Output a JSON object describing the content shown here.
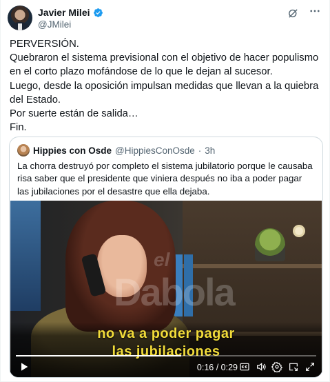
{
  "author": {
    "display_name": "Javier Milei",
    "handle": "@JMilei",
    "verified": true
  },
  "icons": {
    "verified": "verified-badge-icon",
    "grok": "grok-icon",
    "more": "more-options-icon",
    "play": "play-icon",
    "captions": "closed-captions-icon",
    "volume": "volume-icon",
    "settings": "gear-icon",
    "pip": "picture-in-picture-icon",
    "fullscreen": "fullscreen-icon"
  },
  "tweet": {
    "text": "PERVERSIÓN.\nQuebraron el sistema previsional con el objetivo de hacer populismo en el corto plazo mofándose de lo que le dejan al sucesor.\nLuego, desde la oposición impulsan medidas que llevan a la quiebra del Estado.\nPor suerte están de salida…\nFin."
  },
  "quote": {
    "display_name": "Hippies con Osde",
    "handle": "@HippiesConOsde",
    "separator": "·",
    "time": "3h",
    "text": "La chorra destruyó por completo el sistema jubilatorio porque le causaba risa saber que el presidente que viniera después no iba a poder pagar las jubilaciones por el desastre que ella dejaba."
  },
  "video": {
    "caption_line1": "no va a poder pagar",
    "caption_line2": "las jubilaciones",
    "watermark": "Dabola",
    "watermark_small": "el",
    "time_display": "0:16 / 0:29",
    "progress_fraction": 0.55,
    "caption_color": "#f2dc3a"
  },
  "colors": {
    "verified_blue": "#1d9bf0",
    "secondary_text": "#536471",
    "border": "#cfd9de"
  }
}
